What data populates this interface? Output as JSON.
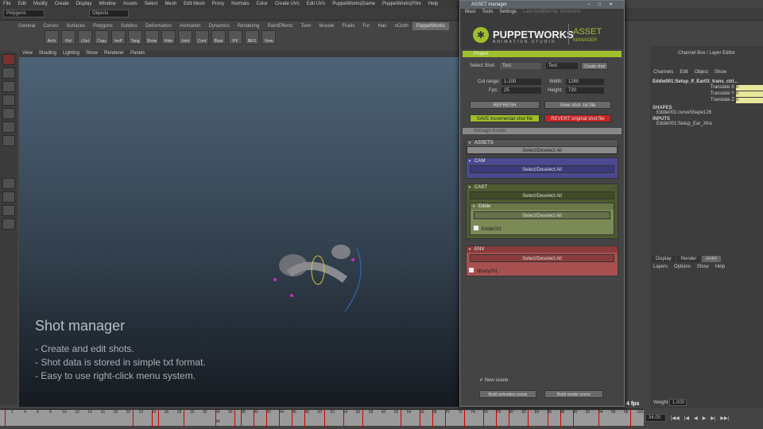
{
  "menubar": [
    "File",
    "Edit",
    "Modify",
    "Create",
    "Display",
    "Window",
    "Assets",
    "Select",
    "Mesh",
    "Edit Mesh",
    "Proxy",
    "Normals",
    "Color",
    "Create UVs",
    "Edit UVs",
    "PuppetWorks|Game",
    "PuppetWorks|Film",
    "Help"
  ],
  "toolbar": {
    "mode": "Polygons",
    "selection": "Objects"
  },
  "shelf_tabs": [
    "General",
    "Curves",
    "Surfaces",
    "Polygons",
    "Subdivs",
    "Deformation",
    "Animation",
    "Dynamics",
    "Rendering",
    "PaintEffects",
    "Toon",
    "Muscle",
    "Fluids",
    "Fur",
    "Hair",
    "nCloth",
    "PuppetWorks"
  ],
  "shelf_icons": [
    "Arch",
    "Rot",
    "cSet",
    "Copy",
    "InsP",
    "Tang",
    "Show",
    "Hide",
    "Joint",
    "Cont",
    "Blast",
    "IFF",
    "BEO",
    "View"
  ],
  "viewport_menu": [
    "View",
    "Shading",
    "Lighting",
    "Show",
    "Renderer",
    "Panels"
  ],
  "overlay": {
    "title": "Shot manager",
    "bullets": [
      "- Create and edit shots.",
      "- Shot data is stored in simple txt format.",
      "- Easy to use right-click menu system."
    ]
  },
  "fps": "4 fps",
  "timeline": {
    "ticks": [
      2,
      4,
      6,
      8,
      10,
      12,
      14,
      16,
      18,
      20,
      22,
      24,
      26,
      28,
      30,
      32,
      34,
      36,
      38,
      40,
      42,
      44,
      46,
      48,
      50,
      52,
      54,
      56,
      58,
      60,
      62,
      64,
      66,
      68,
      70,
      72,
      74,
      76,
      78,
      80,
      82,
      84,
      86,
      88,
      90,
      92,
      94,
      96,
      98,
      100
    ],
    "keys": [
      1,
      21,
      24,
      25,
      29,
      34,
      37,
      38,
      40,
      42,
      44,
      46,
      48,
      51,
      54,
      57,
      63,
      66,
      68,
      70,
      73,
      76,
      78,
      80,
      83,
      86,
      88,
      90,
      94,
      99
    ],
    "current": "34",
    "current_field": "34.00"
  },
  "channel_box": {
    "title": "Channel Box / Layer Editor",
    "menu": [
      "Channels",
      "Edit",
      "Object",
      "Show"
    ],
    "object": "Eddie001:Setup_lf_Ear03_trans_ctrl...",
    "attrs": [
      {
        "name": "Translate X",
        "value": "0"
      },
      {
        "name": "Translate Y",
        "value": "0"
      },
      {
        "name": "Translate Z",
        "value": "0"
      }
    ],
    "shapes_label": "SHAPES",
    "shape": "Eddie001:curveShape126",
    "inputs_label": "INPUTS",
    "input": "Eddie001:Setup_Ear_Xtra"
  },
  "layer_editor": {
    "tabs": [
      "Display",
      "Render",
      "Anim"
    ],
    "menu": [
      "Layers",
      "Options",
      "Show",
      "Help"
    ]
  },
  "weight_label": "Weight",
  "weight_value": "1.000",
  "asset_manager": {
    "title": "ASSET manager",
    "menu": [
      "Blast",
      "Tools",
      "Settings"
    ],
    "last_modified": "Last modified by: bmorrens",
    "logo": {
      "name": "PUPPETWORKS",
      "sub": "ANIMATION STUDIO",
      "asset": "ASSET",
      "manager": "MANAGER"
    },
    "project_label": "Project",
    "select_shot_label": "Select Shot:",
    "select_shot_value": "Test",
    "shot_name": "Test",
    "create_shot": "Create shot",
    "cut_range_label": "Cut range:",
    "cut_range": "1-100",
    "fps_label": "Fps:",
    "fps": "25",
    "width_label": "Width:",
    "width": "1280",
    "height_label": "Height:",
    "height": "720",
    "refresh": "REFRESH",
    "view_shot": "View shot .txt file",
    "save": "SAVE incremental shot file",
    "revert": "REVERT original shot file",
    "manage_label": "Manage Assets",
    "assets_label": "ASSETS",
    "select_all": "Select/Deselect All",
    "cam_label": "CAM",
    "cast_label": "CAST",
    "eddie_label": "Eddie",
    "eddie_item": "Eddie001",
    "env_label": "ENV",
    "env_item": "library001",
    "new_scene": "New scene",
    "build_anim": "Build animation scene",
    "build_render": "Build render scene",
    "colors": {
      "green": "#9fbf2b",
      "red": "#c82424",
      "cam": "#4b4a8e",
      "cast": "#4e5a30",
      "env": "#8a3c3c"
    }
  }
}
